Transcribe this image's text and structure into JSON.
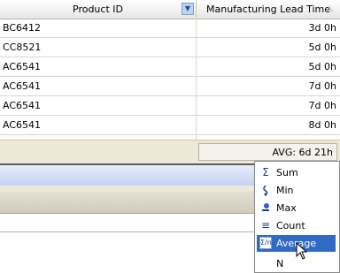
{
  "grid": {
    "columns": [
      {
        "label": "Product ID",
        "filter_icon": "chevron-down-icon"
      },
      {
        "label": "Manufacturing Lead Time",
        "sort_icon": "sort-ascending-icon"
      }
    ],
    "rows": [
      {
        "product_id": "BC6412",
        "lead_time": "3d 0h"
      },
      {
        "product_id": "CC8521",
        "lead_time": "5d 0h"
      },
      {
        "product_id": "AC6541",
        "lead_time": "5d 0h"
      },
      {
        "product_id": "AC6541",
        "lead_time": "7d 0h"
      },
      {
        "product_id": "AC6541",
        "lead_time": "7d 0h"
      },
      {
        "product_id": "AC6541",
        "lead_time": "8d 0h"
      }
    ],
    "summary": "AVG: 6d 21h"
  },
  "summary_menu": {
    "items": [
      {
        "label": "Sum",
        "icon": "sigma-icon"
      },
      {
        "label": "Min",
        "icon": "min-icon"
      },
      {
        "label": "Max",
        "icon": "max-icon"
      },
      {
        "label": "Count",
        "icon": "count-icon"
      },
      {
        "label": "Average",
        "icon": "average-icon",
        "selected": true
      },
      {
        "label": "N",
        "icon": ""
      }
    ]
  },
  "colors": {
    "selection": "#316ac5",
    "header_bg": "#ece9d8",
    "panel_blue": "#c3d2f3"
  }
}
